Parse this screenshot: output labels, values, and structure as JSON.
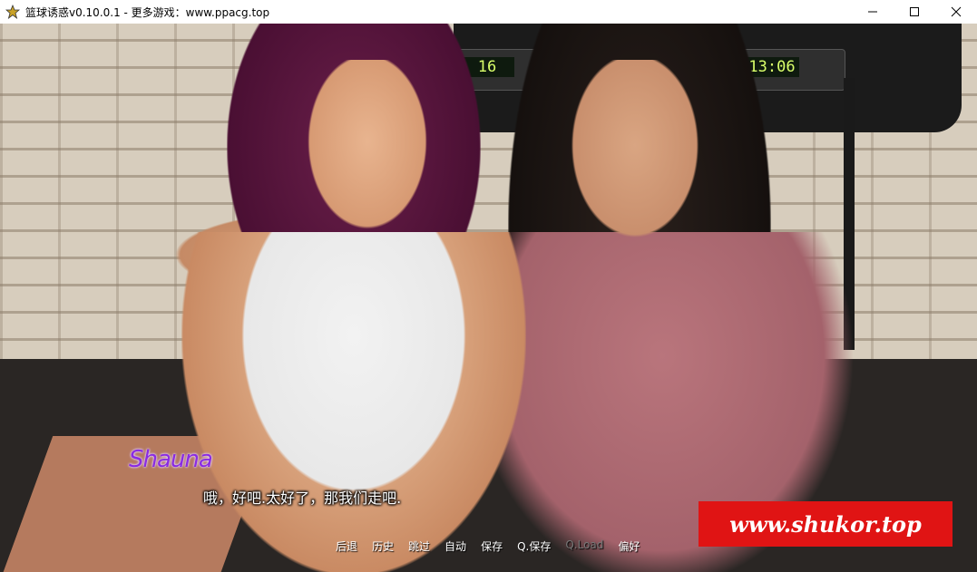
{
  "window": {
    "title": "篮球诱惑v0.10.0.1 - 更多游戏：www.ppacg.top",
    "icon": "star-icon",
    "controls": [
      "minimize-icon",
      "maximize-icon",
      "close-icon"
    ]
  },
  "scene": {
    "treadmill_display_left": "16",
    "treadmill_display_right": "13:06"
  },
  "dialogue": {
    "speaker": "Shauna",
    "text": "哦，好吧.太好了，那我们走吧."
  },
  "watermark": {
    "text": "www.shukor.top",
    "color": "#e01414"
  },
  "quick_menu": {
    "items": [
      {
        "label": "后退",
        "enabled": true
      },
      {
        "label": "历史",
        "enabled": true
      },
      {
        "label": "跳过",
        "enabled": true
      },
      {
        "label": "自动",
        "enabled": true
      },
      {
        "label": "保存",
        "enabled": true
      },
      {
        "label": "Q.保存",
        "enabled": true
      },
      {
        "label": "Q.Load",
        "enabled": false
      },
      {
        "label": "偏好",
        "enabled": true
      }
    ]
  },
  "colors": {
    "speaker_name": "#8a2be2",
    "dialogue_text": "#ffffff"
  }
}
